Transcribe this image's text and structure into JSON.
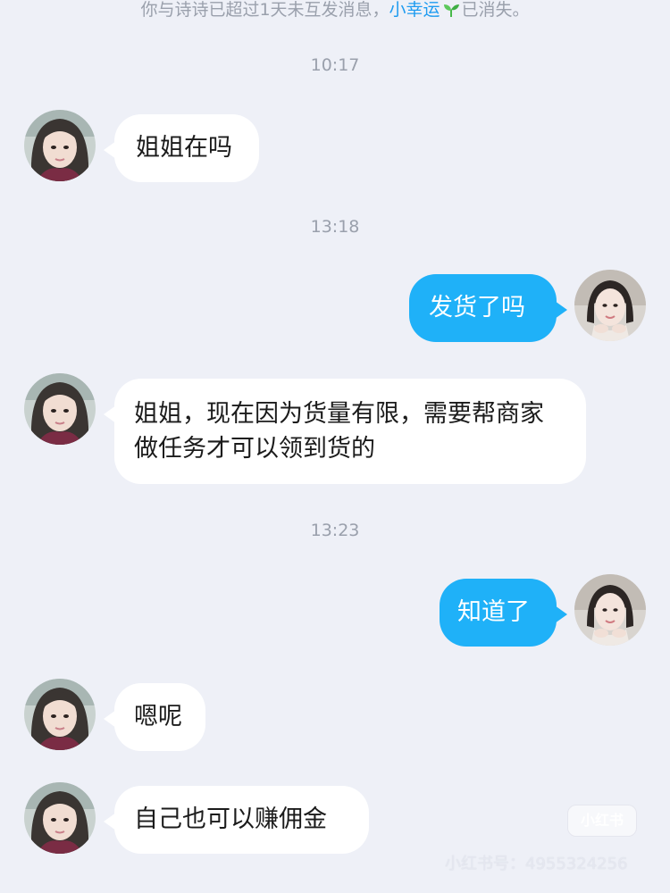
{
  "notice": {
    "prefix": "你与诗诗已超过1天未互发消息，",
    "link": "小幸运",
    "suffix": "已消失。"
  },
  "timestamps": [
    "10:17",
    "13:18",
    "13:23"
  ],
  "messages": [
    {
      "side": "received",
      "text": "姐姐在吗"
    },
    {
      "side": "sent",
      "text": "发货了吗"
    },
    {
      "side": "received",
      "text": "姐姐，现在因为货量有限，需要帮商家做任务才可以领到货的"
    },
    {
      "side": "sent",
      "text": "知道了"
    },
    {
      "side": "received",
      "text": "嗯呢"
    },
    {
      "side": "received",
      "text": "自己也可以赚佣金"
    }
  ],
  "watermark": {
    "badge": "小红书",
    "id": "小红书号：4955324256"
  },
  "colors": {
    "background": "#eef0f7",
    "sent_bubble": "#1fb1f8",
    "received_bubble": "#ffffff",
    "link": "#1e9bf0"
  }
}
